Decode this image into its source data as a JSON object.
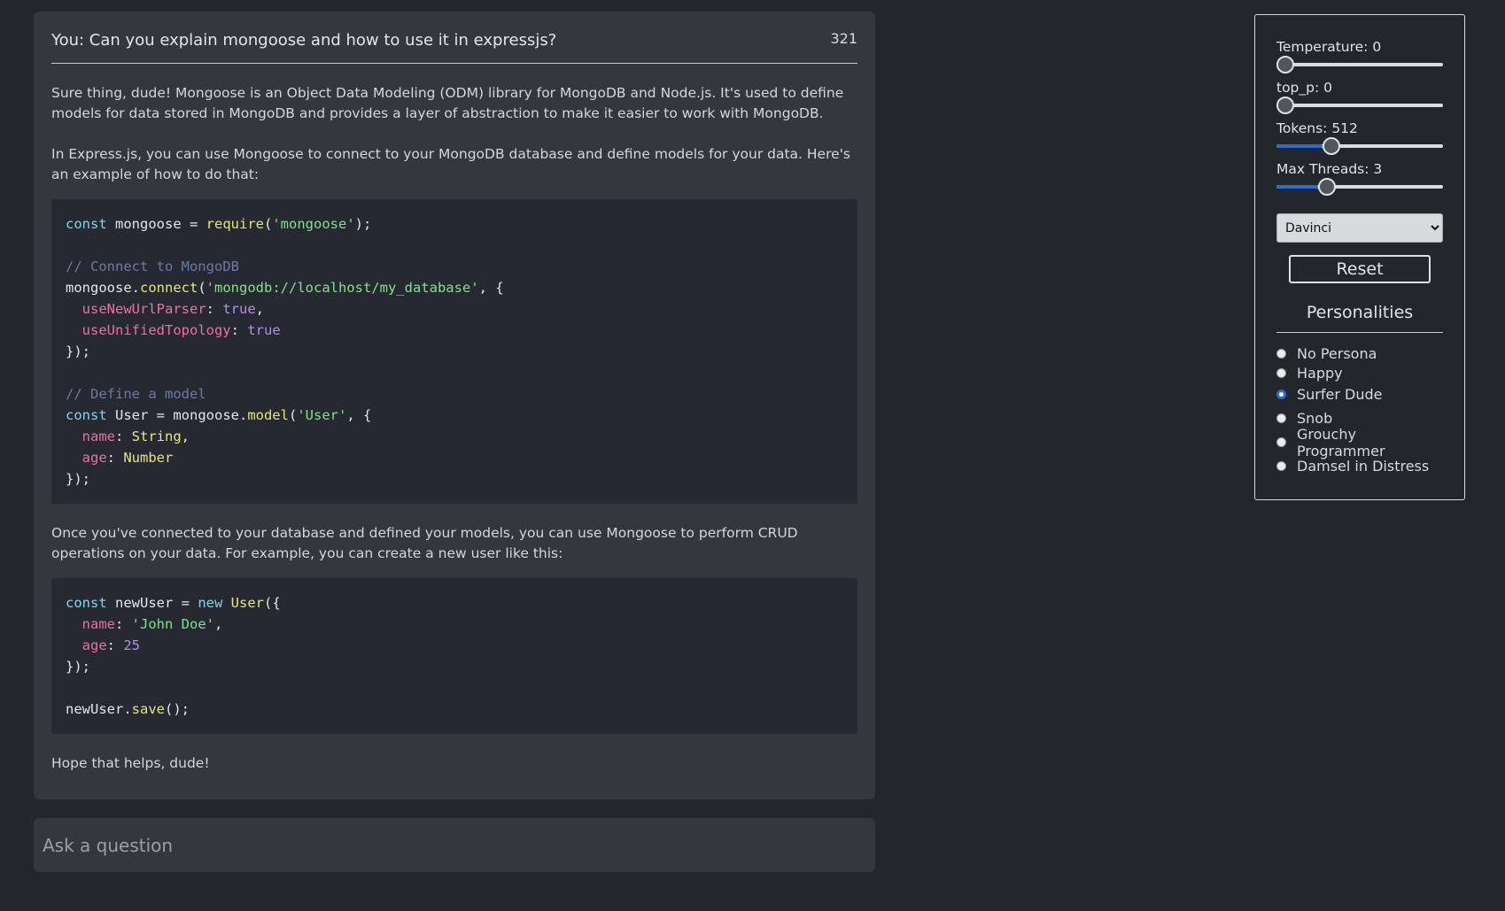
{
  "chat": {
    "question": "You: Can you explain mongoose and how to use it in expressjs?",
    "token_count": "321",
    "paragraphs": [
      "Sure thing, dude! Mongoose is an Object Data Modeling (ODM) library for MongoDB and Node.js. It's used to define models for data stored in MongoDB and provides a layer of abstraction to make it easier to work with MongoDB.",
      "In Express.js, you can use Mongoose to connect to your MongoDB database and define models for your data. Here's an example of how to do that:",
      "Once you've connected to your database and defined your models, you can use Mongoose to perform CRUD operations on your data. For example, you can create a new user like this:",
      "Hope that helps, dude!"
    ],
    "code_blocks": [
      "const mongoose = require('mongoose');\n\n// Connect to MongoDB\nmongoose.connect('mongodb://localhost/my_database', {\n  useNewUrlParser: true,\n  useUnifiedTopology: true\n});\n\n// Define a model\nconst User = mongoose.model('User', {\n  name: String,\n  age: Number\n});",
      "const newUser = new User({\n  name: 'John Doe',\n  age: 25\n});\n\nnewUser.save();"
    ]
  },
  "input": {
    "placeholder": "Ask a question"
  },
  "settings": {
    "sliders": [
      {
        "label": "Temperature: 0",
        "value": 0,
        "min": 0,
        "max": 1
      },
      {
        "label": "top_p: 0",
        "value": 0,
        "min": 0,
        "max": 1
      },
      {
        "label": "Tokens: 512",
        "value": 512,
        "fraction": 0.275
      },
      {
        "label": "Max Threads: 3",
        "value": 3,
        "fraction": 0.25
      }
    ],
    "model_select": {
      "selected": "Davinci"
    },
    "reset_label": "Reset",
    "personalities_title": "Personalities",
    "personas": [
      {
        "label": "No Persona",
        "checked": false
      },
      {
        "label": "Happy",
        "checked": false
      },
      {
        "label": "Surfer Dude",
        "checked": true
      },
      {
        "label": "Snob",
        "checked": false
      },
      {
        "label": "Grouchy Programmer",
        "checked": false
      },
      {
        "label": "Damsel in Distress",
        "checked": false
      }
    ],
    "accent_color": "#2a6bd6"
  }
}
